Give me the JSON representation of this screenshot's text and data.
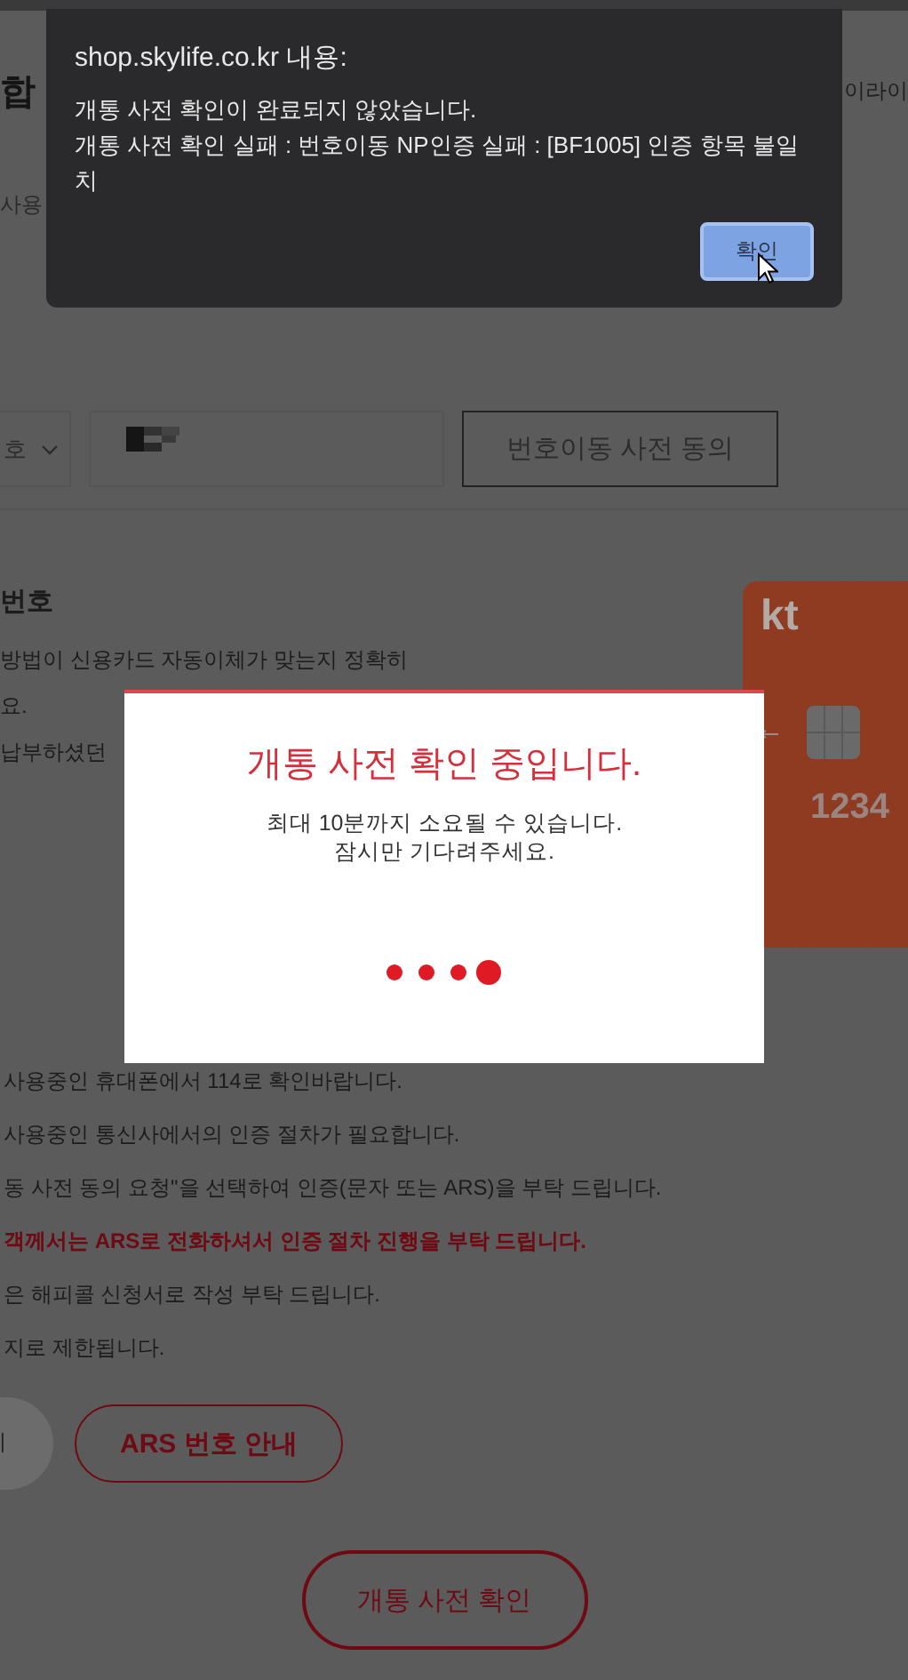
{
  "page": {
    "heading": "합",
    "header_right": "이라이",
    "subtext": "사용",
    "number_select": {
      "value": "호"
    },
    "consent_button": "번호이동 사전 동의",
    "section_title": "번호",
    "notes": [
      "방법이 신용카드 자동이체가 맞는지 정확히",
      "요.",
      "납부하셨던"
    ],
    "card": {
      "logo": "kt",
      "number": "1234"
    },
    "guide_lines": [
      {
        "kind": "normal",
        "text": "사용중인 휴대폰에서 114로 확인바랍니다."
      },
      {
        "kind": "normal",
        "text": "사용중인 통신사에서의 인증 절차가 필요합니다."
      },
      {
        "kind": "normal",
        "text": "동 사전 동의 요청\"을 선택하여 인증(문자 또는 ARS)을 부탁 드립니다."
      },
      {
        "kind": "emphasis",
        "text": "객께서는 ARS로 전화하셔서 인증 절차 진행을 부탁 드립니다."
      },
      {
        "kind": "normal",
        "text": "은 해피콜 신청서로 작성 부탁 드립니다."
      },
      {
        "kind": "normal",
        "text": "지로 제한됩니다."
      }
    ],
    "circle_button": "ㅣ",
    "ars_button": "ARS 번호 안내",
    "submit_button": "개통 사전 확인"
  },
  "loading_modal": {
    "title": "개통 사전 확인 중입니다.",
    "lines": [
      "최대 10분까지 소요될 수 있습니다.",
      "잠시만 기다려주세요."
    ]
  },
  "browser_dialog": {
    "title": "shop.skylife.co.kr 내용:",
    "message_lines": [
      "개통 사전 확인이 완료되지 않았습니다.",
      "개통 사전 확인 실패 : 번호이동 NP인증 실패 : [BF1005] 인증 항목 불일치"
    ],
    "button": "확인"
  }
}
